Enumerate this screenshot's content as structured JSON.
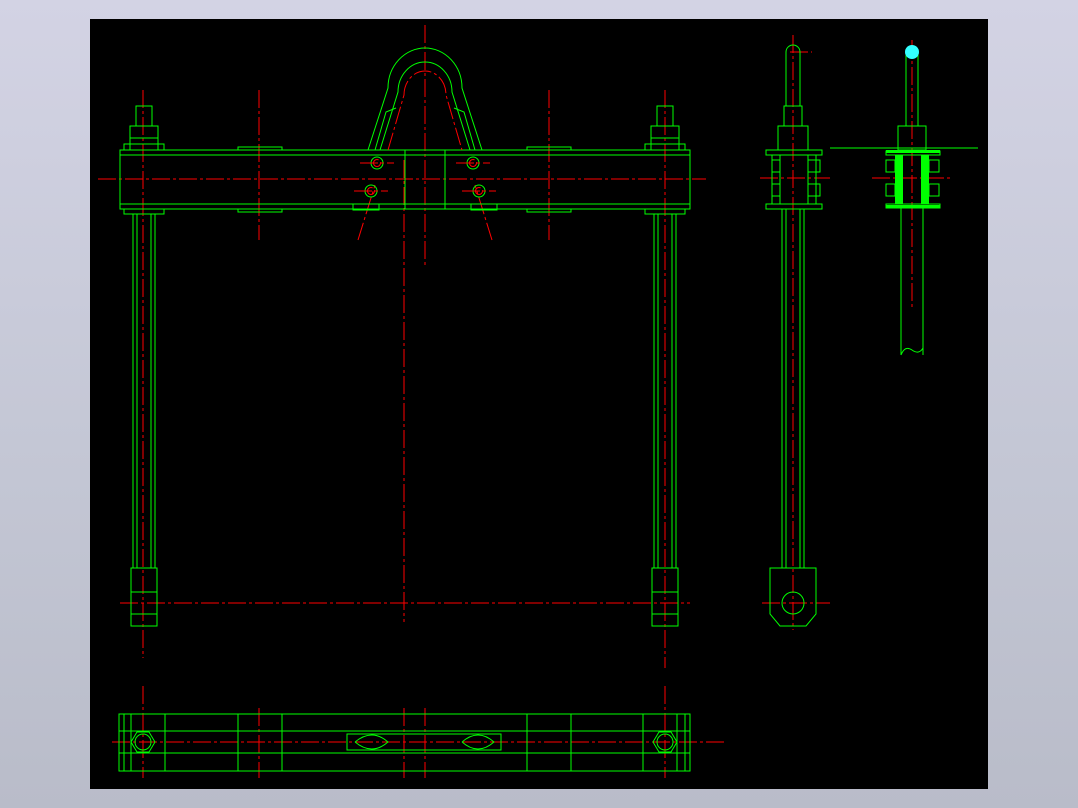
{
  "viewport": {
    "background": "#000000",
    "outline_color": "#00ff00",
    "centerline_color": "#ff0000",
    "highlight_color": "#33ffff",
    "section_fill_color": "#00ff00"
  },
  "drawing": {
    "views": [
      "front-view",
      "side-view",
      "section-view",
      "top-view"
    ],
    "centerline_style": "dash-dot",
    "grip_marker_icon": "cyan-circle-grip-icon"
  }
}
